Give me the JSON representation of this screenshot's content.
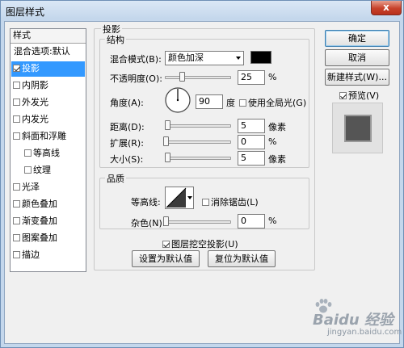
{
  "window": {
    "title": "图层样式",
    "close_label": "x"
  },
  "style_list": {
    "header": "样式",
    "items": [
      {
        "label": "混合选项:默认",
        "checkbox": false,
        "selected": false,
        "indent": false
      },
      {
        "label": "投影",
        "checkbox": true,
        "checked": true,
        "selected": true,
        "indent": false
      },
      {
        "label": "内阴影",
        "checkbox": true,
        "checked": false,
        "selected": false,
        "indent": false
      },
      {
        "label": "外发光",
        "checkbox": true,
        "checked": false,
        "selected": false,
        "indent": false
      },
      {
        "label": "内发光",
        "checkbox": true,
        "checked": false,
        "selected": false,
        "indent": false
      },
      {
        "label": "斜面和浮雕",
        "checkbox": true,
        "checked": false,
        "selected": false,
        "indent": false
      },
      {
        "label": "等高线",
        "checkbox": true,
        "checked": false,
        "selected": false,
        "indent": true
      },
      {
        "label": "纹理",
        "checkbox": true,
        "checked": false,
        "selected": false,
        "indent": true
      },
      {
        "label": "光泽",
        "checkbox": true,
        "checked": false,
        "selected": false,
        "indent": false
      },
      {
        "label": "颜色叠加",
        "checkbox": true,
        "checked": false,
        "selected": false,
        "indent": false
      },
      {
        "label": "渐变叠加",
        "checkbox": true,
        "checked": false,
        "selected": false,
        "indent": false
      },
      {
        "label": "图案叠加",
        "checkbox": true,
        "checked": false,
        "selected": false,
        "indent": false
      },
      {
        "label": "描边",
        "checkbox": true,
        "checked": false,
        "selected": false,
        "indent": false
      }
    ]
  },
  "drop_shadow": {
    "title": "投影",
    "structure": {
      "title": "结构",
      "blend_mode_label": "混合模式(B):",
      "blend_mode_value": "颜色加深",
      "shadow_color": "#000000",
      "opacity_label": "不透明度(O):",
      "opacity_value": "25",
      "opacity_fraction": 0.25,
      "percent": "%",
      "angle_label": "角度(A):",
      "angle_value": "90",
      "angle_unit": "度",
      "global_light_label": "使用全局光(G)",
      "global_light_checked": false,
      "distance_label": "距离(D):",
      "distance_value": "5",
      "spread_label": "扩展(R):",
      "spread_value": "0",
      "size_label": "大小(S):",
      "size_value": "5",
      "pixel_unit": "像素"
    },
    "quality": {
      "title": "品质",
      "contour_label": "等高线:",
      "anti_aliased_label": "消除锯齿(L)",
      "anti_aliased_checked": false,
      "noise_label": "杂色(N):",
      "noise_value": "0",
      "percent": "%"
    },
    "knockout_label": "图层挖空投影(U)",
    "knockout_checked": true,
    "set_default_label": "设置为默认值",
    "reset_default_label": "复位为默认值"
  },
  "buttons": {
    "ok": "确定",
    "cancel": "取消",
    "new_style": "新建样式(W)...",
    "preview_label": "预览(V)",
    "preview_checked": true
  },
  "watermark": {
    "main": "Baidu 经验",
    "sub": "jingyan.baidu.com"
  },
  "icons": {
    "paw": "paw-icon",
    "angle_dial": "dial-icon",
    "contour": "contour-curve-icon"
  }
}
